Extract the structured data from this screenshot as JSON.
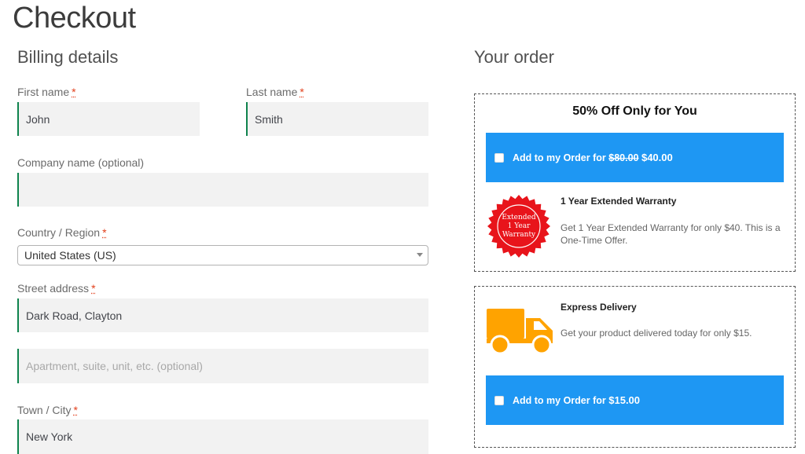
{
  "page": {
    "title": "Checkout"
  },
  "billing": {
    "heading": "Billing details",
    "required_mark": "*",
    "first_name": {
      "label": "First name",
      "value": "John"
    },
    "last_name": {
      "label": "Last name",
      "value": "Smith"
    },
    "company": {
      "label": "Company name (optional)",
      "value": ""
    },
    "country": {
      "label": "Country / Region",
      "value": "United States (US)"
    },
    "street": {
      "label": "Street address",
      "value": "Dark Road, Clayton",
      "placeholder2": "Apartment, suite, unit, etc. (optional)"
    },
    "city": {
      "label": "Town / City",
      "value": "New York"
    }
  },
  "order": {
    "heading": "Your order",
    "offer1": {
      "headline": "50% Off Only for You",
      "add_label": "Add to my Order for",
      "old_price": "$80.00",
      "new_price": "$40.00",
      "badge_lines": [
        "Extended",
        "1 Year",
        "Warranty"
      ],
      "title": "1 Year Extended Warranty",
      "description": "Get 1 Year Extended Warranty for only $40. This is a One-Time Offer."
    },
    "offer2": {
      "title": "Express Delivery",
      "description": "Get your product delivered today for only $15.",
      "add_label": "Add to my Order for",
      "price": "$15.00",
      "icon": "truck-icon"
    }
  },
  "colors": {
    "accent_blue": "#1e97f3",
    "field_border_green": "#0f834d",
    "required_red": "#e2401c",
    "badge_red": "#e8141b",
    "truck_orange": "#ffa300"
  }
}
